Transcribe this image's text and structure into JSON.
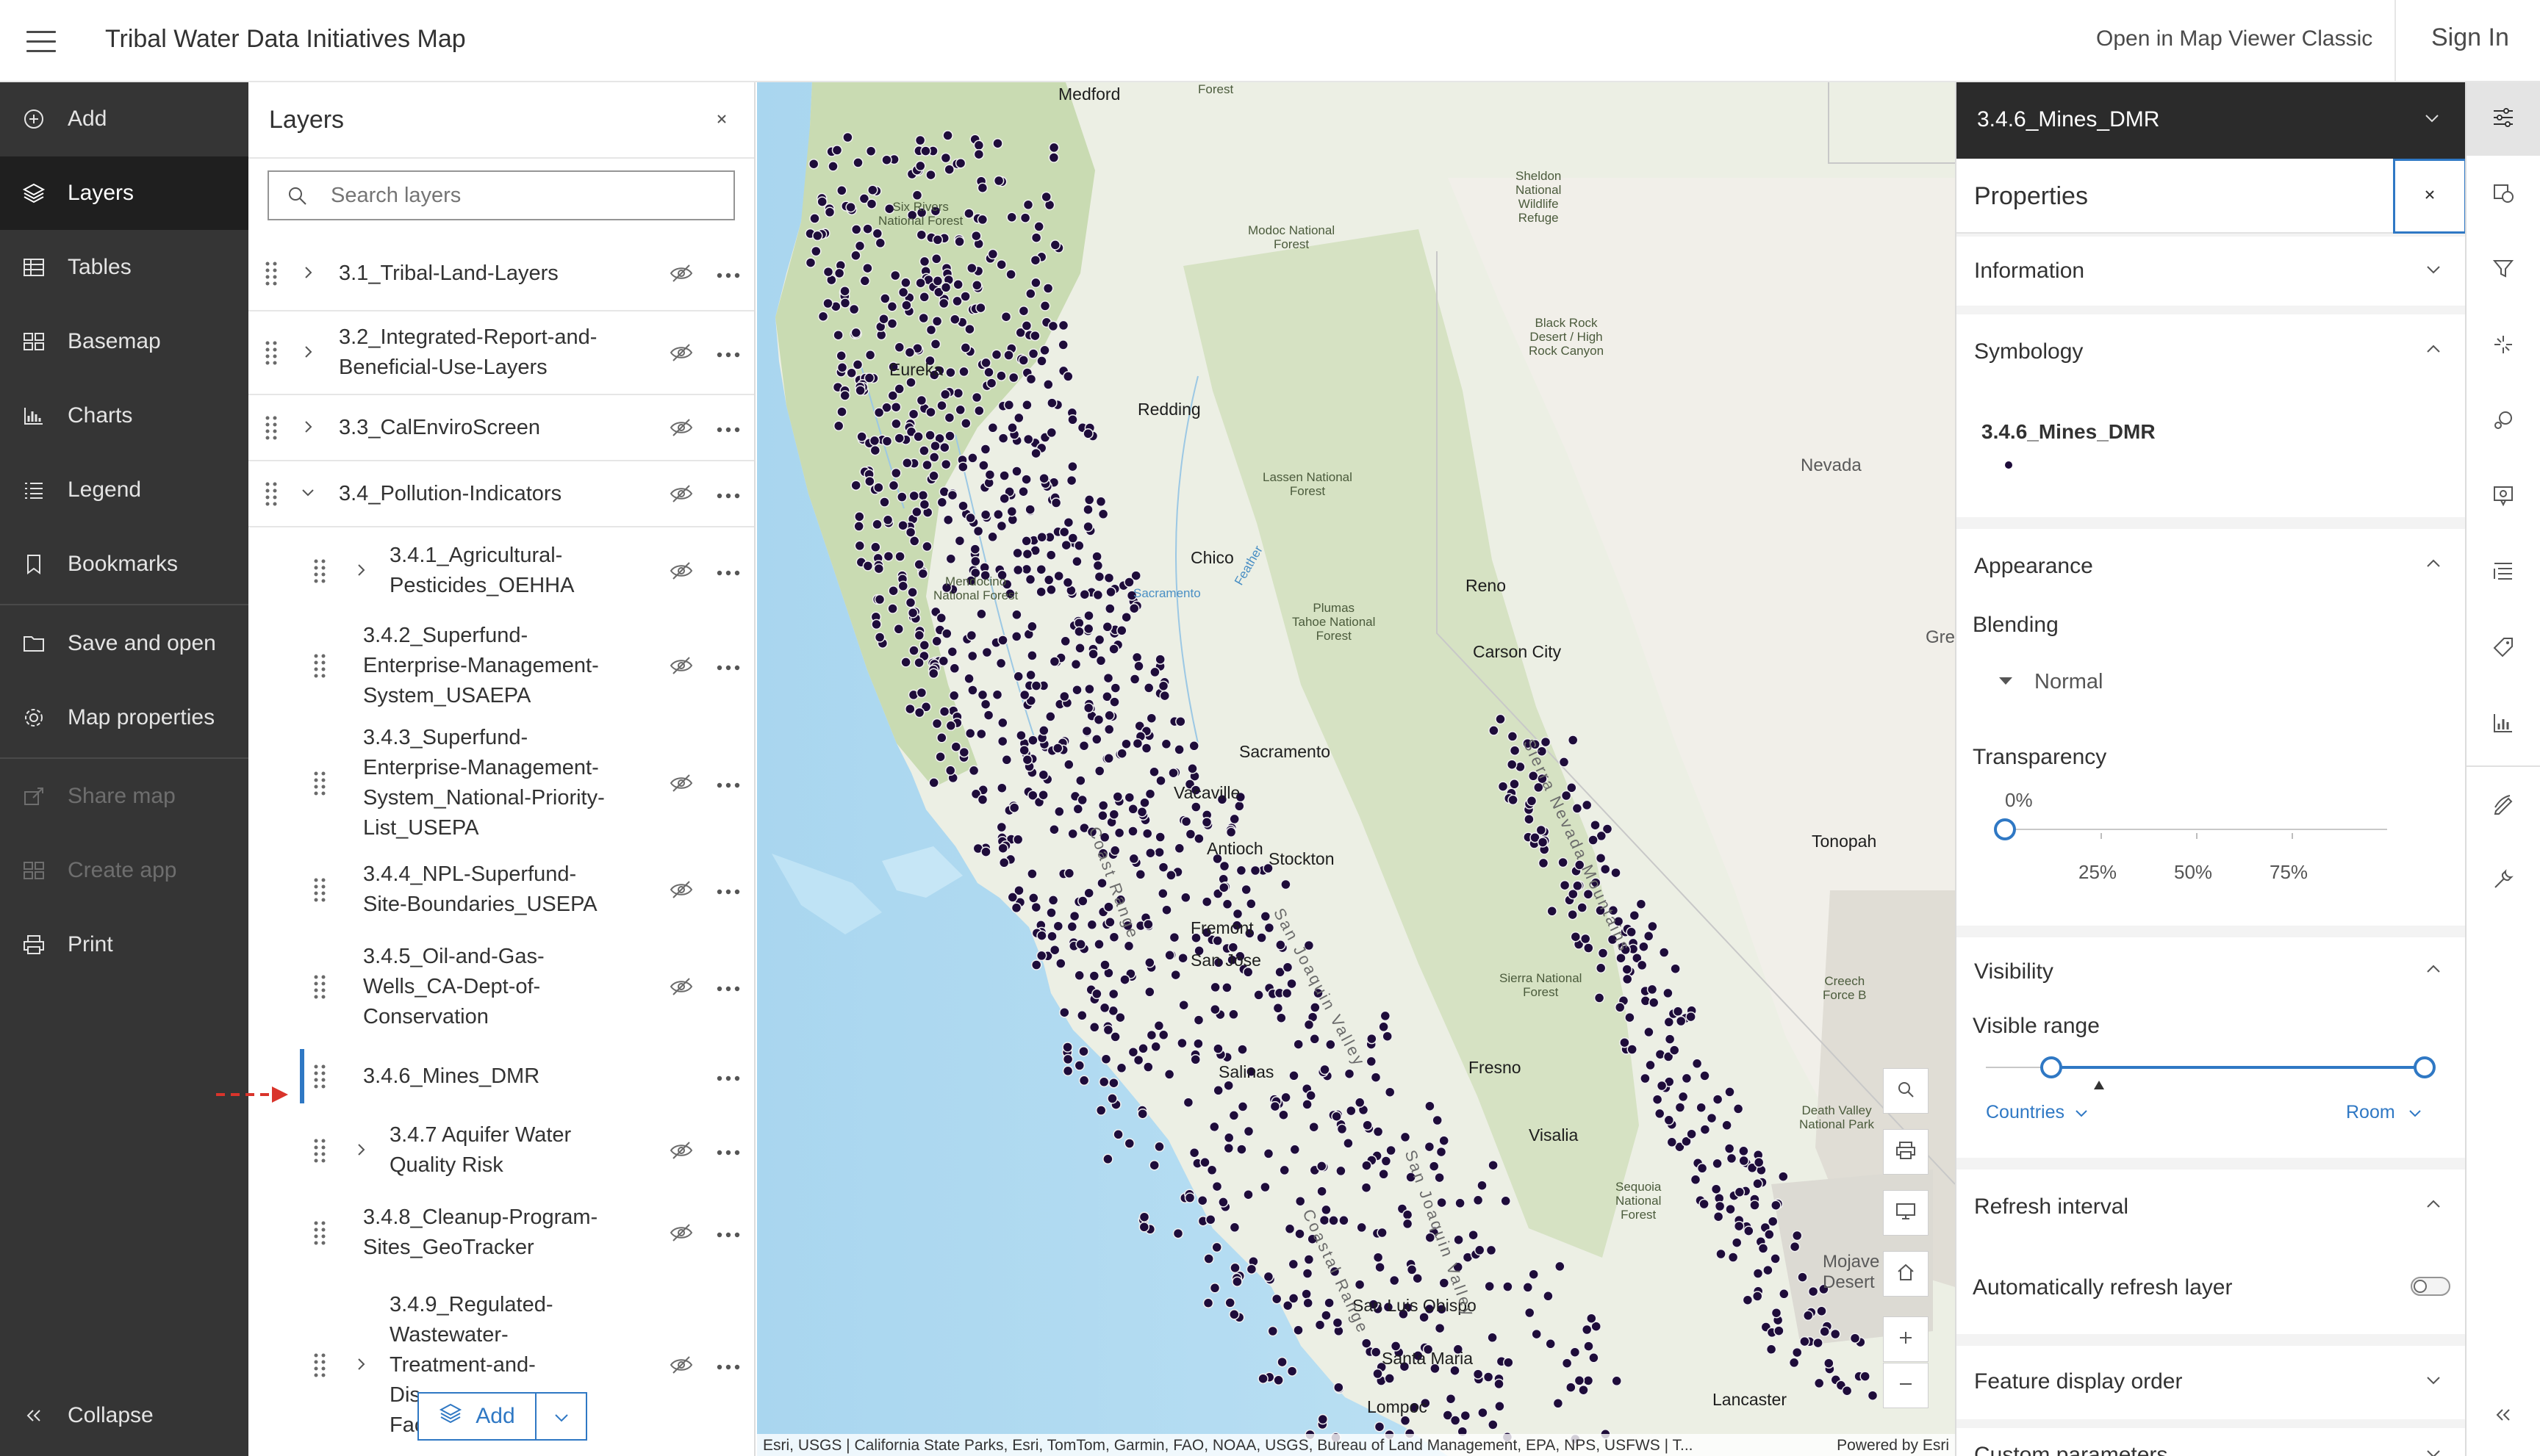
{
  "header": {
    "title": "Tribal Water Data Initiatives Map",
    "open_classic": "Open in Map Viewer Classic",
    "sign_in": "Sign In"
  },
  "nav": {
    "items": [
      {
        "label": "Add",
        "icon": "add-icon",
        "state": "normal"
      },
      {
        "label": "Layers",
        "icon": "layers-icon",
        "state": "active"
      },
      {
        "label": "Tables",
        "icon": "table-icon",
        "state": "normal"
      },
      {
        "label": "Basemap",
        "icon": "basemap-icon",
        "state": "normal"
      },
      {
        "label": "Charts",
        "icon": "chart-icon",
        "state": "normal"
      },
      {
        "label": "Legend",
        "icon": "legend-icon",
        "state": "normal"
      },
      {
        "label": "Bookmarks",
        "icon": "bookmark-icon",
        "state": "normal"
      },
      {
        "label": "Save and open",
        "icon": "folder-icon",
        "state": "normal"
      },
      {
        "label": "Map properties",
        "icon": "gear-icon",
        "state": "normal"
      },
      {
        "label": "Share map",
        "icon": "share-icon",
        "state": "disabled"
      },
      {
        "label": "Create app",
        "icon": "apps-icon",
        "state": "disabled"
      },
      {
        "label": "Print",
        "icon": "print-icon",
        "state": "normal"
      }
    ],
    "collapse": "Collapse"
  },
  "layers_panel": {
    "title": "Layers",
    "search_placeholder": "Search layers",
    "rows": [
      {
        "lines": [
          "3.1_Tribal-Land-Layers"
        ],
        "expandable": true
      },
      {
        "lines": [
          "3.2_Integrated-Report-and-",
          "Beneficial-Use-Layers"
        ],
        "expandable": true
      },
      {
        "lines": [
          "3.3_CalEnviroScreen"
        ],
        "expandable": true
      },
      {
        "lines": [
          "3.4_Pollution-Indicators"
        ],
        "expandable": true,
        "expanded": true
      },
      {
        "lines": [
          "3.4.1_Agricultural-",
          "Pesticides_OEHHA"
        ],
        "expandable": true
      },
      {
        "lines": [
          "3.4.2_Superfund-",
          "Enterprise-Management-",
          "System_USAEPA"
        ],
        "expandable": false
      },
      {
        "lines": [
          "3.4.3_Superfund-",
          "Enterprise-Management-",
          "System_National-Priority-",
          "List_USEPA"
        ],
        "expandable": false
      },
      {
        "lines": [
          "3.4.4_NPL-Superfund-",
          "Site-Boundaries_USEPA"
        ],
        "expandable": false
      },
      {
        "lines": [
          "3.4.5_Oil-and-Gas-",
          "Wells_CA-Dept-of-",
          "Conservation"
        ],
        "expandable": false
      },
      {
        "lines": [
          "3.4.6_Mines_DMR"
        ],
        "expandable": false,
        "selected": true
      },
      {
        "lines": [
          "3.4.7 Aquifer Water",
          "Quality Risk"
        ],
        "expandable": true
      },
      {
        "lines": [
          "3.4.8_Cleanup-Program-",
          "Sites_GeoTracker"
        ],
        "expandable": false
      },
      {
        "lines": [
          "3.4.9_Regulated-",
          "Wastewater-",
          "Treatment-and-",
          "Dis",
          "Facilities_CIWQS"
        ],
        "expandable": true
      }
    ],
    "add_label": "Add"
  },
  "map": {
    "places": [
      {
        "t": "Medford",
        "k": "city"
      },
      {
        "t": "Six Rivers\nNational Forest",
        "k": "small"
      },
      {
        "t": "Modoc National\nForest",
        "k": "small"
      },
      {
        "t": "Sheldon\nNational\nWildlife\nRefuge",
        "k": "small"
      },
      {
        "t": "Black Rock\nDesert / High\nRock Canyon",
        "k": "small"
      },
      {
        "t": "Eureka",
        "k": "city"
      },
      {
        "t": "Redding",
        "k": "city"
      },
      {
        "t": "Lassen National\nForest",
        "k": "small"
      },
      {
        "t": "Nevada",
        "k": "region"
      },
      {
        "t": "Chico",
        "k": "city"
      },
      {
        "t": "Feather",
        "k": "water"
      },
      {
        "t": "Mendocino\nNational Forest",
        "k": "small"
      },
      {
        "t": "Reno",
        "k": "city"
      },
      {
        "t": "Plumas\nTahoe National\nForest",
        "k": "small"
      },
      {
        "t": "Carson City",
        "k": "city"
      },
      {
        "t": "Sacramento",
        "k": "water"
      },
      {
        "t": "Sacramento",
        "k": "city"
      },
      {
        "t": "Vacaville",
        "k": "city"
      },
      {
        "t": "Antioch",
        "k": "city"
      },
      {
        "t": "Stockton",
        "k": "city"
      },
      {
        "t": "Tonopah",
        "k": "city"
      },
      {
        "t": "Fremont",
        "k": "city"
      },
      {
        "t": "San Jose",
        "k": "city"
      },
      {
        "t": "Sierra National\nForest",
        "k": "small"
      },
      {
        "t": "Creech\nForce B",
        "k": "small"
      },
      {
        "t": "Salinas",
        "k": "city"
      },
      {
        "t": "Fresno",
        "k": "city"
      },
      {
        "t": "Visalia",
        "k": "city"
      },
      {
        "t": "Death Valley\nNational Park",
        "k": "small"
      },
      {
        "t": "Sequoia\nNational\nForest",
        "k": "small"
      },
      {
        "t": "Mojave\nDesert",
        "k": "region"
      },
      {
        "t": "San Luis Obispo",
        "k": "city"
      },
      {
        "t": "Santa Maria",
        "k": "city"
      },
      {
        "t": "Lompoc",
        "k": "city"
      },
      {
        "t": "Lancaster",
        "k": "city"
      },
      {
        "t": "Gre",
        "k": "region"
      },
      {
        "t": "Sierra Nevada Mountains",
        "k": "range"
      },
      {
        "t": "Coast Range",
        "k": "range"
      },
      {
        "t": "San Joaquin Valley",
        "k": "range"
      },
      {
        "t": "Coastal Range",
        "k": "range"
      },
      {
        "t": "San Joaquin Valley",
        "k": "range"
      },
      {
        "t": "Forest",
        "k": "small"
      }
    ],
    "attribution": "Esri, USGS | California State Parks, Esri, TomTom, Garmin, FAO, NOAA, USGS, Bureau of Land Management, EPA, NPS, USFWS | T...",
    "powered": "Powered by Esri",
    "controls": [
      "search-icon",
      "print-icon",
      "screen-icon",
      "home-icon",
      "zoom-in-icon",
      "zoom-out-icon"
    ]
  },
  "properties": {
    "layer_name": "3.4.6_Mines_DMR",
    "title": "Properties",
    "sections": {
      "information": "Information",
      "symbology": "Symbology",
      "appearance": "Appearance",
      "visibility": "Visibility",
      "refresh": "Refresh interval",
      "display_order": "Feature display order",
      "custom": "Custom parameters"
    },
    "symbology_layer": "3.4.6_Mines_DMR",
    "blending_label": "Blending",
    "blending_value": "Normal",
    "transparency_label": "Transparency",
    "transparency_value": "0%",
    "transparency_level": 0,
    "transparency_ticks": [
      "25%",
      "50%",
      "75%"
    ],
    "visible_range_label": "Visible range",
    "range_min": "Countries",
    "range_max": "Room",
    "auto_refresh_label": "Automatically refresh layer",
    "auto_refresh_on": false
  },
  "colors": {
    "accent": "#2f78c4",
    "nav_bg": "#353535",
    "point": "#1e0c3a",
    "selection_arrow": "#d9342b"
  },
  "tools": [
    "properties-icon",
    "styles-icon",
    "filter-icon",
    "effects-icon",
    "clustering-icon",
    "popups-icon",
    "fields-icon",
    "labels-icon",
    "charts-icon",
    "sketch-icon",
    "configure-icon",
    "collapse-icon"
  ]
}
